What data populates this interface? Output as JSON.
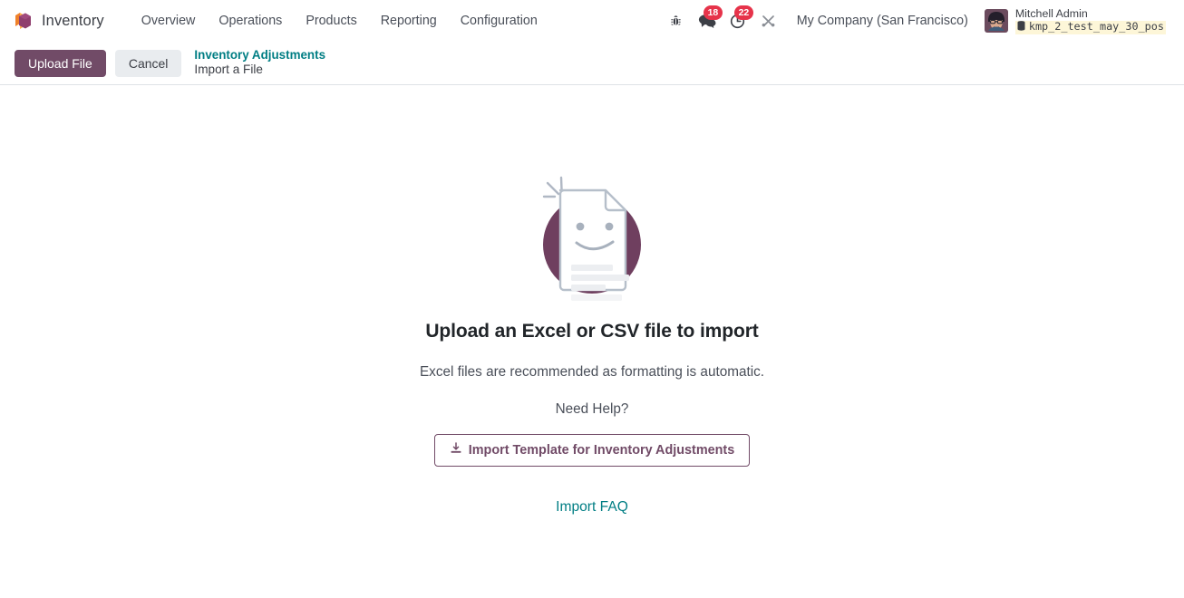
{
  "navbar": {
    "logo_icon": "odoo-box-icon",
    "brand": "Inventory",
    "menu": [
      {
        "label": "Overview"
      },
      {
        "label": "Operations"
      },
      {
        "label": "Products"
      },
      {
        "label": "Reporting"
      },
      {
        "label": "Configuration"
      }
    ],
    "systray": {
      "bug_icon": "bug-icon",
      "messages_icon": "chat-bubbles-icon",
      "messages_count": "18",
      "activities_icon": "clock-icon",
      "activities_count": "22",
      "tools_icon": "tools-icon"
    },
    "company": "My Company (San Francisco)",
    "user": {
      "avatar_icon": "user-avatar",
      "name": "Mitchell Admin",
      "database_icon": "database-icon",
      "database": "kmp_2_test_may_30_pos"
    }
  },
  "control_panel": {
    "upload_label": "Upload File",
    "cancel_label": "Cancel",
    "breadcrumb_parent": "Inventory Adjustments",
    "breadcrumb_current": "Import a File"
  },
  "main": {
    "illustration_icon": "smiling-document-icon",
    "headline": "Upload an Excel or CSV file to import",
    "subtext": "Excel files are recommended as formatting is automatic.",
    "help_text": "Need Help?",
    "template_icon": "download-icon",
    "template_label": "Import Template for Inventory Adjustments",
    "faq_label": "Import FAQ"
  },
  "colors": {
    "primary": "#714B67",
    "accent_teal": "#017E84",
    "badge_red": "#E6334A",
    "db_badge_bg": "#FDF6D8"
  }
}
